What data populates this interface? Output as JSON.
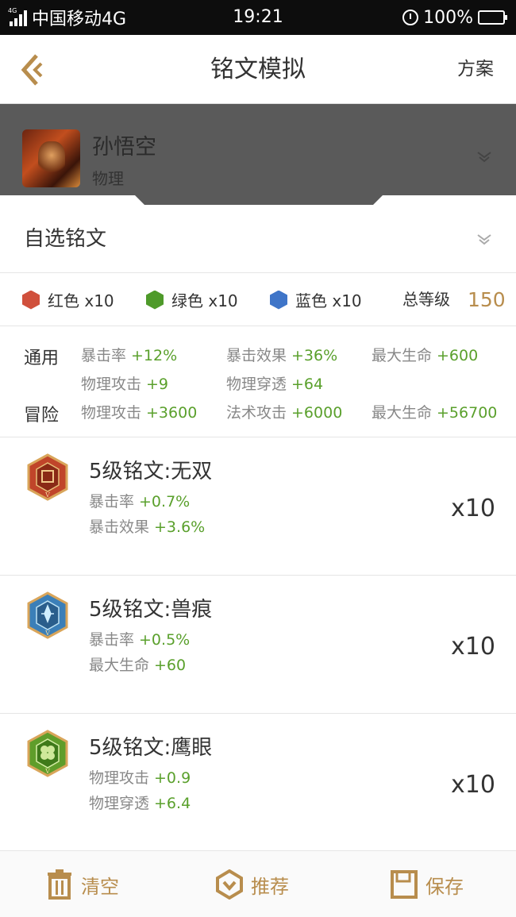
{
  "status_bar": {
    "signal_tag": "4G",
    "carrier": "中国移动4G",
    "time": "19:21",
    "battery": "100%"
  },
  "title_bar": {
    "title": "铭文模拟",
    "plan_label": "方案"
  },
  "hero": {
    "name": "孙悟空",
    "type": "物理"
  },
  "custom": {
    "label": "自选铭文"
  },
  "colors": {
    "items": [
      {
        "name": "红色 x10",
        "color": "#d0503c"
      },
      {
        "name": "绿色 x10",
        "color": "#4e9a2a"
      },
      {
        "name": "蓝色 x10",
        "color": "#3f75c8"
      }
    ],
    "total_label": "总等级",
    "total_value": "150"
  },
  "stats": {
    "general_label": "通用",
    "adventure_label": "冒险",
    "general": [
      {
        "name": "暴击率",
        "value": "+12%"
      },
      {
        "name": "暴击效果",
        "value": "+36%"
      },
      {
        "name": "最大生命",
        "value": "+600"
      },
      {
        "name": "物理攻击",
        "value": "+9"
      },
      {
        "name": "物理穿透",
        "value": "+64"
      }
    ],
    "adventure": [
      {
        "name": "物理攻击",
        "value": "+3600"
      },
      {
        "name": "法术攻击",
        "value": "+6000"
      },
      {
        "name": "最大生命",
        "value": "+56700"
      }
    ]
  },
  "runes": [
    {
      "title": "5级铭文:无双",
      "stat1_name": "暴击率",
      "stat1_value": "+0.7%",
      "stat2_name": "暴击效果",
      "stat2_value": "+3.6%",
      "count": "x10",
      "icon": "red-rune-icon",
      "color": "#c0452a"
    },
    {
      "title": "5级铭文:兽痕",
      "stat1_name": "暴击率",
      "stat1_value": "+0.5%",
      "stat2_name": "最大生命",
      "stat2_value": "+60",
      "count": "x10",
      "icon": "blue-rune-icon",
      "color": "#3b7fb8"
    },
    {
      "title": "5级铭文:鹰眼",
      "stat1_name": "物理攻击",
      "stat1_value": "+0.9",
      "stat2_name": "物理穿透",
      "stat2_value": "+6.4",
      "count": "x10",
      "icon": "green-rune-icon",
      "color": "#5f9d2a"
    }
  ],
  "bottom_bar": {
    "clear_label": "清空",
    "recommend_label": "推荐",
    "save_label": "保存"
  },
  "accent_color": "#b88d4d"
}
